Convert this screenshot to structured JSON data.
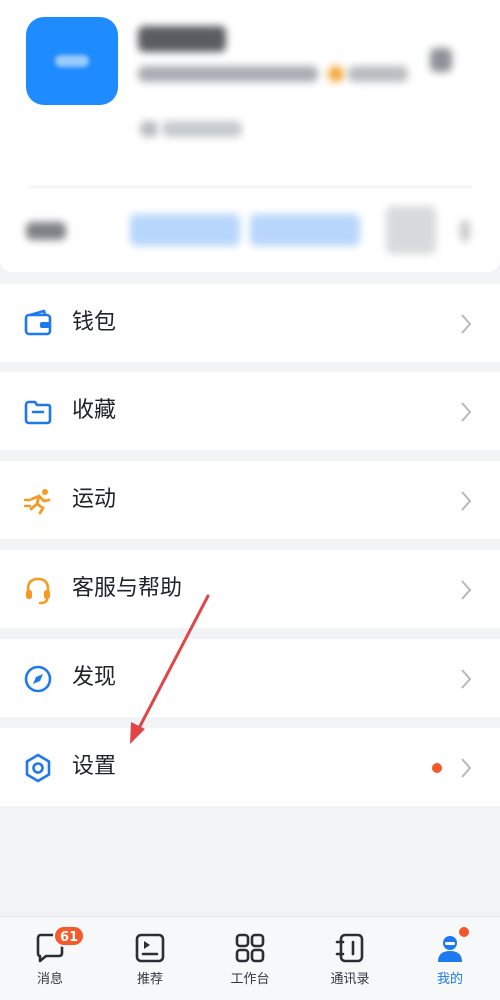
{
  "menu": {
    "items": [
      {
        "id": "wallet",
        "label": "钱包",
        "icon": "wallet-icon",
        "color": "#1e78f0"
      },
      {
        "id": "favorites",
        "label": "收藏",
        "icon": "folder-icon",
        "color": "#1e78f0"
      },
      {
        "id": "sports",
        "label": "运动",
        "icon": "running-icon",
        "color": "#f59a23"
      },
      {
        "id": "support",
        "label": "客服与帮助",
        "icon": "headset-icon",
        "color": "#f59a23"
      },
      {
        "id": "discover",
        "label": "发现",
        "icon": "compass-icon",
        "color": "#1e78f0"
      },
      {
        "id": "settings",
        "label": "设置",
        "icon": "gear-icon",
        "color": "#1e78f0",
        "has_dot": true
      }
    ]
  },
  "tabbar": {
    "tabs": [
      {
        "id": "messages",
        "label": "消息",
        "icon": "chat-icon",
        "badge": "61"
      },
      {
        "id": "recommend",
        "label": "推荐",
        "icon": "feed-icon"
      },
      {
        "id": "workbench",
        "label": "工作台",
        "icon": "grid-icon"
      },
      {
        "id": "contacts",
        "label": "通讯录",
        "icon": "contacts-icon"
      },
      {
        "id": "me",
        "label": "我的",
        "icon": "user-icon",
        "active": true,
        "has_dot": true
      }
    ]
  },
  "colors": {
    "accent": "#1e78f0",
    "badge": "#f45a2a",
    "annotation_arrow": "#e0454a"
  }
}
